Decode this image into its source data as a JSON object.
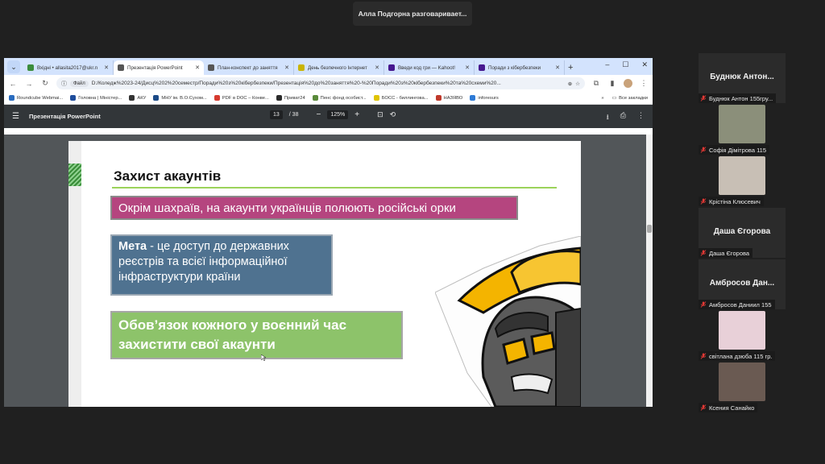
{
  "banner": {
    "text": "Алла Подгорна разговаривает..."
  },
  "browser": {
    "tabs": [
      {
        "title": "Вхідні • allasita2017@ukr.n",
        "favicon": "mail-icon",
        "color": "#3c8d3c",
        "active": false
      },
      {
        "title": "Презентація PowerPoint",
        "favicon": "globe-icon",
        "color": "#555555",
        "active": true
      },
      {
        "title": "План-конспект до заняття",
        "favicon": "globe-icon",
        "color": "#555555",
        "active": false
      },
      {
        "title": "День безпечного Інтернет",
        "favicon": "dp-icon",
        "color": "#c9b400",
        "active": false
      },
      {
        "title": "Введи код гри — Kahoot!",
        "favicon": "kahoot-icon",
        "color": "#46178f",
        "active": false
      },
      {
        "title": "Поради з кібербезпеки",
        "favicon": "kahoot-icon",
        "color": "#46178f",
        "active": false
      }
    ],
    "new_tab": "+",
    "omnibox": {
      "chip": "Файл",
      "url": "D:/Коледж%2023-24/Дисц%202%20семестр/Поради%20з%20кібербезпеки/Презентація%20до%20заняття%20-%20Поради%20з%20кібербезпеки%20та%20схеми%20..."
    },
    "bookmarks": [
      {
        "label": "Roundcube Webmai...",
        "color": "#2a6cbf"
      },
      {
        "label": "Головна | Міністер...",
        "color": "#1f4d9c"
      },
      {
        "label": "АКУ",
        "color": "#333333"
      },
      {
        "label": "МНУ ім. В.О.Сухом...",
        "color": "#1c4b87"
      },
      {
        "label": "PDF в DOC – Конве...",
        "color": "#d63a2f"
      },
      {
        "label": "Приват24",
        "color": "#2b2b2b"
      },
      {
        "label": "Пенс фонд особист...",
        "color": "#5a8a3a"
      },
      {
        "label": "БОСС - биллингова...",
        "color": "#e0c400"
      },
      {
        "label": "НАЗЯВО",
        "color": "#c0392b"
      },
      {
        "label": "inforesurs",
        "color": "#2e7bd6"
      }
    ],
    "bookmarks_more": "»",
    "all_bookmarks": "Все закладки"
  },
  "pdf": {
    "title": "Презентація PowerPoint",
    "page_current": "13",
    "page_total": "/ 38",
    "zoom": "125%"
  },
  "slide": {
    "title": "Захист акаунтів",
    "box1": "Окрім шахраїв, на акаунти українців полюють російські орки",
    "box2_bold": "Мета",
    "box2_rest": " - це доступ до державних реєстрів та всієї інформаційної інфраструктури країни",
    "box3": "Обов’язок кожного у воєнний час захистити свої акаунти"
  },
  "participants": [
    {
      "name": "Буднюк Антон...",
      "label": "Буднюк Антон 155гру...",
      "has_photo": false
    },
    {
      "name": "",
      "label": "Софія Дімітрова 115",
      "has_photo": true,
      "photo_color": "#8b8f7a"
    },
    {
      "name": "",
      "label": "Крістіна Клюсевич",
      "has_photo": true,
      "photo_color": "#c8bfb5"
    },
    {
      "name": "Даша Єгорова",
      "label": "Даша Єгорова",
      "has_photo": false
    },
    {
      "name": "Амбросов Дан...",
      "label": "Амбросов Даниил 155",
      "has_photo": false
    },
    {
      "name": "",
      "label": "світлана дзюба 115 гр.",
      "has_photo": true,
      "photo_color": "#e8d0d8"
    },
    {
      "name": "",
      "label": "Ксения Санайко",
      "has_photo": true,
      "photo_color": "#6a5a52"
    }
  ]
}
